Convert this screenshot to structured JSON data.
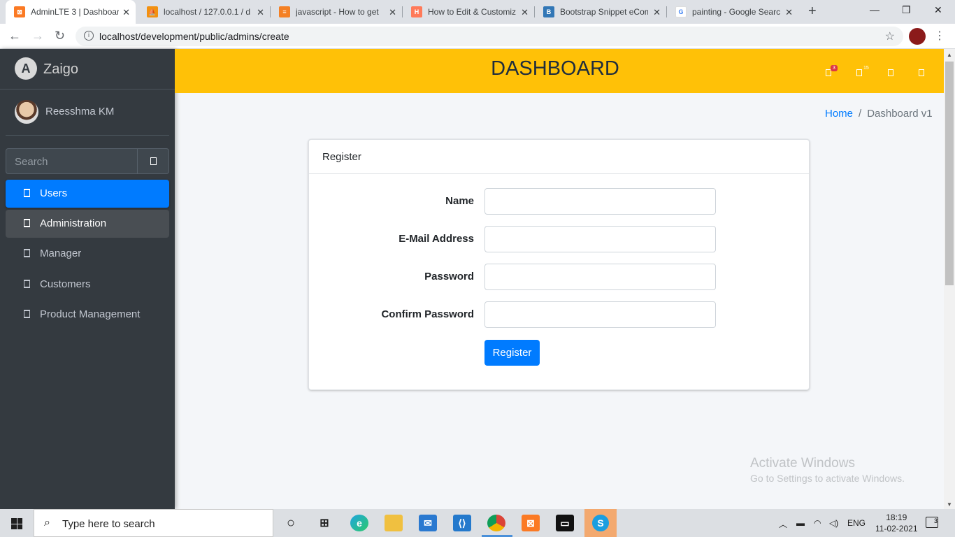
{
  "browser": {
    "tabs": [
      {
        "title": "AdminLTE 3 | Dashboard",
        "icon": "xampp-icon",
        "color": "#fb7a24"
      },
      {
        "title": "localhost / 127.0.0.1 / d",
        "icon": "phpmyadmin-icon",
        "color": "#f29111"
      },
      {
        "title": "javascript - How to get",
        "icon": "stackoverflow-icon",
        "color": "#f48024"
      },
      {
        "title": "How to Edit & Customiz",
        "icon": "hubspot-icon",
        "color": "#ff7a59"
      },
      {
        "title": "Bootstrap Snippet eCom",
        "icon": "bootsnipp-icon",
        "color": "#3277b6"
      },
      {
        "title": "painting - Google Searc",
        "icon": "google-icon",
        "color": "#4285f4"
      }
    ],
    "url": "localhost/development/public/admins/create"
  },
  "sidebar": {
    "brand": "Zaigo",
    "user": "Reesshma KM",
    "search_placeholder": "Search",
    "items": [
      {
        "label": "Users"
      },
      {
        "label": "Administration"
      },
      {
        "label": "Manager"
      },
      {
        "label": "Customers"
      },
      {
        "label": "Product Management"
      }
    ]
  },
  "topnav": {
    "title": "DASHBOARD",
    "notif_badge": "3",
    "message_badge": "15"
  },
  "breadcrumb": {
    "home": "Home",
    "separator": "/",
    "current": "Dashboard v1"
  },
  "card": {
    "header": "Register",
    "fields": [
      {
        "label": "Name",
        "value": ""
      },
      {
        "label": "E-Mail Address",
        "value": ""
      },
      {
        "label": "Password",
        "value": ""
      },
      {
        "label": "Confirm Password",
        "value": ""
      }
    ],
    "submit_label": "Register"
  },
  "watermark": {
    "line1": "Activate Windows",
    "line2": "Go to Settings to activate Windows."
  },
  "taskbar": {
    "search_placeholder": "Type here to search",
    "language": "ENG",
    "time": "18:19",
    "date": "11-02-2021",
    "notification_count": "3"
  },
  "colors": {
    "accent": "#007bff",
    "navbar": "#ffc107",
    "sidebar": "#343a40"
  }
}
